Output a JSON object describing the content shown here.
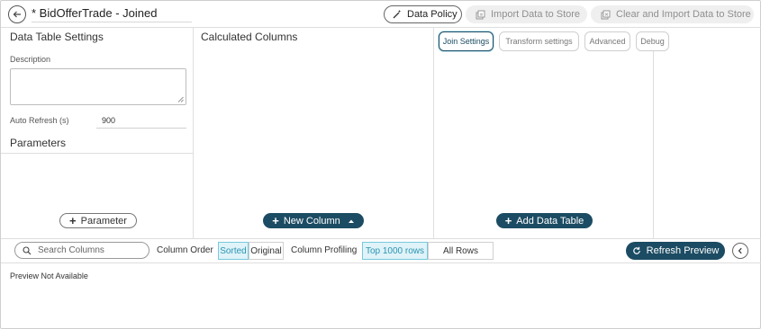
{
  "header": {
    "title": "* BidOfferTrade - Joined",
    "data_policy_label": "Data Policy",
    "import_label": "Import Data to Store",
    "clear_import_label": "Clear and Import Data to Store"
  },
  "settings": {
    "title": "Data Table Settings",
    "description_label": "Description",
    "description_value": "",
    "auto_refresh_label": "Auto Refresh (s)",
    "auto_refresh_value": "900",
    "parameters_title": "Parameters",
    "add_parameter_label": "Parameter"
  },
  "calculated": {
    "title": "Calculated Columns",
    "new_column_label": "New Column"
  },
  "join": {
    "tabs": [
      {
        "label": "Join Settings",
        "active": true
      },
      {
        "label": "Transform settings",
        "active": false
      },
      {
        "label": "Advanced",
        "active": false
      },
      {
        "label": "Debug",
        "active": false
      }
    ],
    "add_table_label": "Add Data Table"
  },
  "toolbar": {
    "search_placeholder": "Search Columns",
    "column_order_label": "Column Order",
    "order_options": [
      "Sorted",
      "Original"
    ],
    "order_selected": "Sorted",
    "profiling_label": "Column Profiling",
    "profiling_options": [
      "Top 1000 rows",
      "All Rows"
    ],
    "profiling_selected": "Top 1000 rows",
    "refresh_label": "Refresh Preview"
  },
  "preview": {
    "message": "Preview Not Available"
  },
  "colors": {
    "primary": "#1c4c63",
    "selected_bg": "#dff3f8",
    "selected_text": "#2a93b3",
    "disabled_bg": "#efefef"
  }
}
